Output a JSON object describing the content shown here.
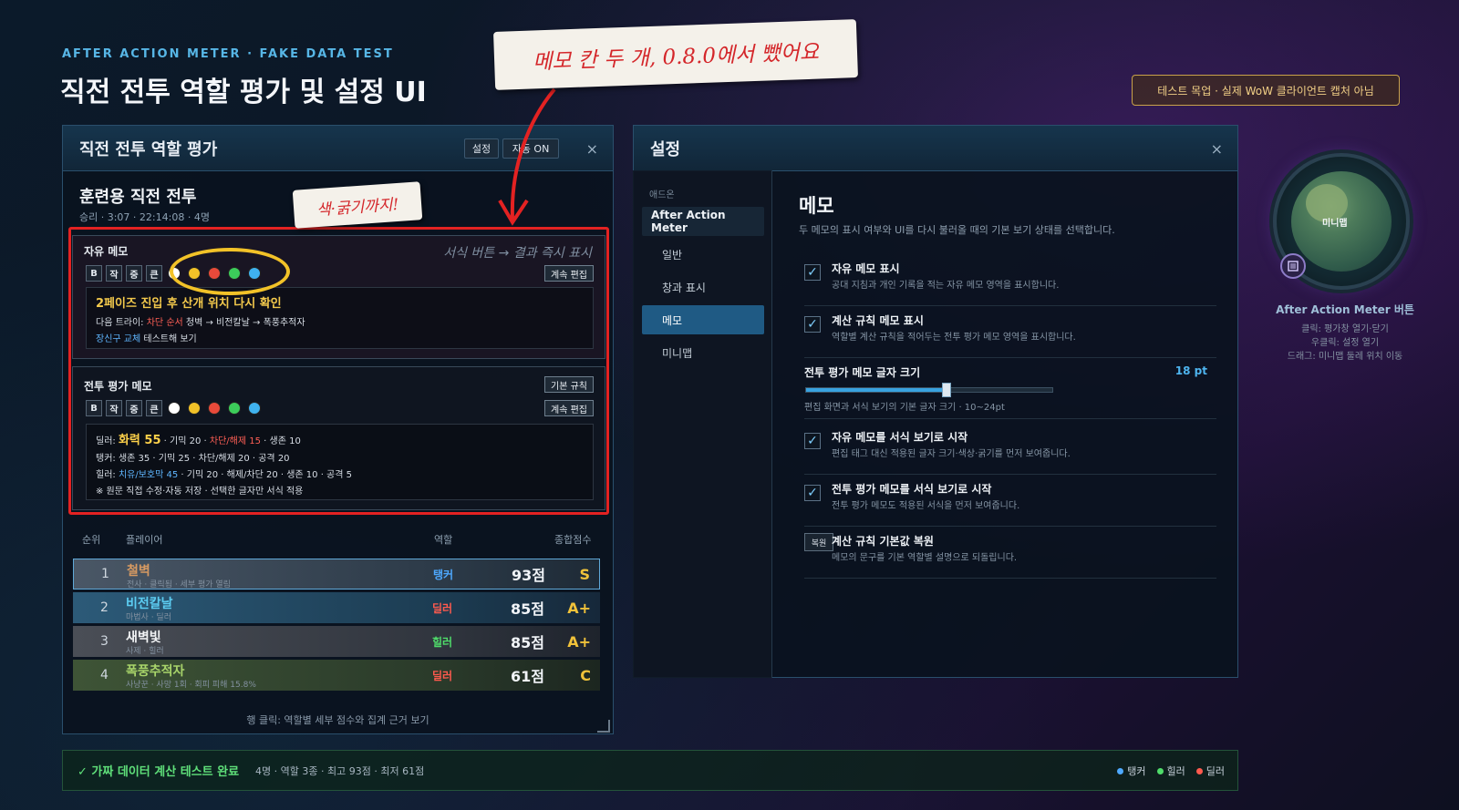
{
  "header": {
    "eyebrow": "AFTER ACTION METER · FAKE DATA TEST",
    "title": "직전 전투 역할 평가 및 설정 UI",
    "warning_badge": "테스트 목업 · 실제 WoW 클라이언트 캡처 아님"
  },
  "annotations": {
    "note_top": "메모 칸 두 개, 0.8.0에서 뺐어요",
    "note_color": "색·굵기까지!"
  },
  "eval_panel": {
    "title": "직전 전투 역할 평가",
    "settings_btn": "설정",
    "auto_btn": "자동 ON",
    "close": "×",
    "session_name": "훈련용 직전 전투",
    "session_meta": "승리 · 3:07 · 22:14:08 · 4명",
    "free_memo": {
      "label": "자유 메모",
      "hint": "서식 버튼 → 결과 즉시 표시",
      "toolbar": [
        "B",
        "작",
        "중",
        "큰"
      ],
      "edit_btn": "계속 편집",
      "line1": "2페이즈 진입 후 산개 위치 다시 확인",
      "line2_pre": "다음 트라이: ",
      "line2_red": "차단 순서",
      "line2_post": " 청벽 → 비전칼날 → 폭풍추적자",
      "line3_blue": "장신구 교체",
      "line3_post": " 테스트해 보기"
    },
    "battle_memo": {
      "label": "전투 평가 메모",
      "default_btn": "기본 규칙",
      "toolbar": [
        "B",
        "작",
        "중",
        "큰"
      ],
      "edit_btn": "계속 편집",
      "dps_pre": "딜러: ",
      "dps_yellow": "화력 55",
      "dps_mid": " · 기믹 20 · ",
      "dps_red": "차단/해제 15",
      "dps_post": " · 생존 10",
      "tank": "탱커: 생존 35 · 기믹 25 · 차단/해제 20 · 공격 20",
      "heal_pre": "힐러: ",
      "heal_blue": "치유/보호막 45",
      "heal_post": " · 기믹 20 · 해제/차단 20 · 생존 10 · 공격 5",
      "note": "※ 원문 직접 수정·자동 저장 · 선택한 글자만 서식 적용"
    },
    "swatches": [
      "#ffffff",
      "#f2c228",
      "#e84a3a",
      "#3ccc5a",
      "#3fb2ee"
    ],
    "table": {
      "headers": [
        "순위",
        "플레이어",
        "역할",
        "종합점수"
      ],
      "rows": [
        {
          "rank": "1",
          "name": "철벽",
          "sub": "전사 · 클릭됨 · 세부 평가 열림",
          "role": "탱커",
          "score": "93점",
          "grade": "S",
          "name_color": "#d79a62",
          "role_color": "#4ea9ff"
        },
        {
          "rank": "2",
          "name": "비전칼날",
          "sub": "마법사 · 딜러",
          "role": "딜러",
          "score": "85점",
          "grade": "A+",
          "name_color": "#5ccdf2",
          "role_color": "#ff5a4e"
        },
        {
          "rank": "3",
          "name": "새벽빛",
          "sub": "사제 · 힐러",
          "role": "힐러",
          "score": "85점",
          "grade": "A+",
          "name_color": "#f2f4f6",
          "role_color": "#4fdc6a"
        },
        {
          "rank": "4",
          "name": "폭풍추적자",
          "sub": "사냥꾼 · 사망 1회 · 회피 피해 15.8%",
          "role": "딜러",
          "score": "61점",
          "grade": "C",
          "name_color": "#a8d46a",
          "role_color": "#ff5a4e"
        }
      ],
      "footer": "행 클릭: 역할별 세부 점수와 집계 근거 보기"
    }
  },
  "settings_panel": {
    "title": "설정",
    "close": "×",
    "nav_category": "애드온",
    "nav": {
      "addon": "After Action Meter",
      "general": "일반",
      "window": "창과 표시",
      "memo": "메모",
      "minimap": "미니맵"
    },
    "section_title": "메모",
    "section_desc": "두 메모의 표시 여부와 UI를 다시 불러올 때의 기본 보기 상태를 선택합니다.",
    "options": [
      {
        "title": "자유 메모 표시",
        "sub": "공대 지침과 개인 기록을 적는 자유 메모 영역을 표시합니다."
      },
      {
        "title": "계산 규칙 메모 표시",
        "sub": "역할별 계산 규칙을 적어두는 전투 평가 메모 영역을 표시합니다."
      }
    ],
    "slider": {
      "title": "전투 평가 메모 글자 크기",
      "value": "18 pt",
      "numeric": 18,
      "min": 10,
      "max": 24,
      "sub": "편집 화면과 서식 보기의 기본 글자 크기 · 10~24pt"
    },
    "options2": [
      {
        "title": "자유 메모를 서식 보기로 시작",
        "sub": "편집 태그 대신 적용된 글자 크기·색상·굵기를 먼저 보여줍니다."
      },
      {
        "title": "전투 평가 메모를 서식 보기로 시작",
        "sub": "전투 평가 메모도 적용된 서식을 먼저 보여줍니다."
      }
    ],
    "restore": {
      "btn": "복원",
      "title": "계산 규칙 기본값 복원",
      "sub": "메모의 문구를 기본 역할별 설명으로 되돌립니다."
    },
    "check": "✓"
  },
  "minimap": {
    "label": "미니맵",
    "icon": "list-icon",
    "title": "After Action Meter 버튼",
    "lines": [
      "클릭: 평가창 열기·닫기",
      "우클릭: 설정 열기",
      "드래그: 미니맵 둘레 위치 이동"
    ]
  },
  "footer": {
    "ok": "✓ 가짜 데이터 계산 테스트 완료",
    "stats": "4명 · 역할 3종 · 최고 93점 · 최저 61점",
    "legend": [
      {
        "label": "탱커",
        "color": "#4ea9ff"
      },
      {
        "label": "힐러",
        "color": "#4fdc6a"
      },
      {
        "label": "딜러",
        "color": "#ff5a4e"
      }
    ]
  }
}
